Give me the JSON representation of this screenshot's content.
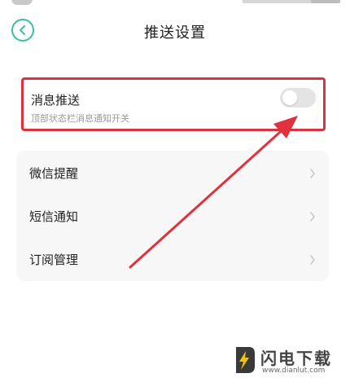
{
  "header": {
    "title": "推送设置"
  },
  "push": {
    "title": "消息推送",
    "subtitle": "顶部状态栏消息通知开关",
    "enabled": false
  },
  "list": {
    "items": [
      {
        "label": "微信提醒"
      },
      {
        "label": "短信通知"
      },
      {
        "label": "订阅管理"
      }
    ]
  },
  "watermark": {
    "name": "闪电下载",
    "url": "www.dianlut.com"
  },
  "colors": {
    "accent": "#3cbfa0",
    "highlight": "#d9333f"
  }
}
